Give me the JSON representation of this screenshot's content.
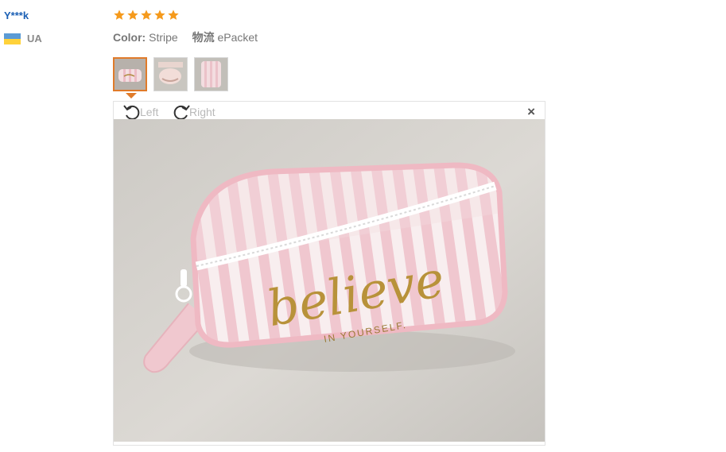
{
  "review": {
    "user": "Y***k",
    "country_code": "UA",
    "rating": 5,
    "color_label": "Color:",
    "color_value": "Stripe",
    "shipping_label": "物流",
    "shipping_value": "ePacket"
  },
  "viewer": {
    "rotate_left": "Left",
    "rotate_right": "Right",
    "close": "×",
    "photo_text": "believe",
    "photo_subtext": "IN YOURSELF."
  },
  "colors": {
    "user_link": "#1a5fb4",
    "star": "#f59a1c",
    "active_thumb": "#e07b2a",
    "flag_top": "#5b9bd5",
    "flag_bottom": "#ffd23a"
  }
}
